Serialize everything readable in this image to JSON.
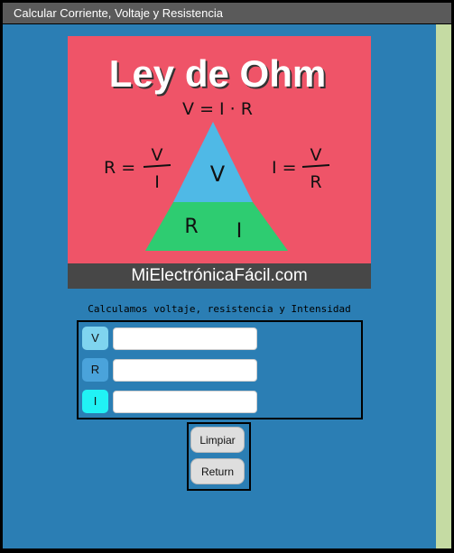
{
  "window": {
    "title": "Calcular Corriente, Voltaje y Resistencia"
  },
  "hero": {
    "heading": "Ley de Ohm",
    "formula_top": "V = I · R",
    "formula_left_lhs": "R =",
    "formula_left_num": "V",
    "formula_left_den": "I",
    "formula_right_lhs": "I =",
    "formula_right_num": "V",
    "formula_right_den": "R",
    "tri_v": "V",
    "tri_r": "R",
    "tri_i": "I",
    "footer": "MiElectrónicaFácil.com",
    "colors": {
      "background": "#ef5468",
      "triangle_top": "#4fb9e6",
      "triangle_bottom": "#2ecc71",
      "footer": "#474747"
    }
  },
  "subtitle": "Calculamos voltaje, resistencia y Intensidad",
  "form": {
    "rows": [
      {
        "label": "V",
        "value": "",
        "color": "#7fd4ef"
      },
      {
        "label": "R",
        "value": "",
        "color": "#4aa3db"
      },
      {
        "label": "I",
        "value": "",
        "color": "#21f2f5"
      }
    ]
  },
  "buttons": {
    "clear": "Limpiar",
    "return": "Return"
  }
}
